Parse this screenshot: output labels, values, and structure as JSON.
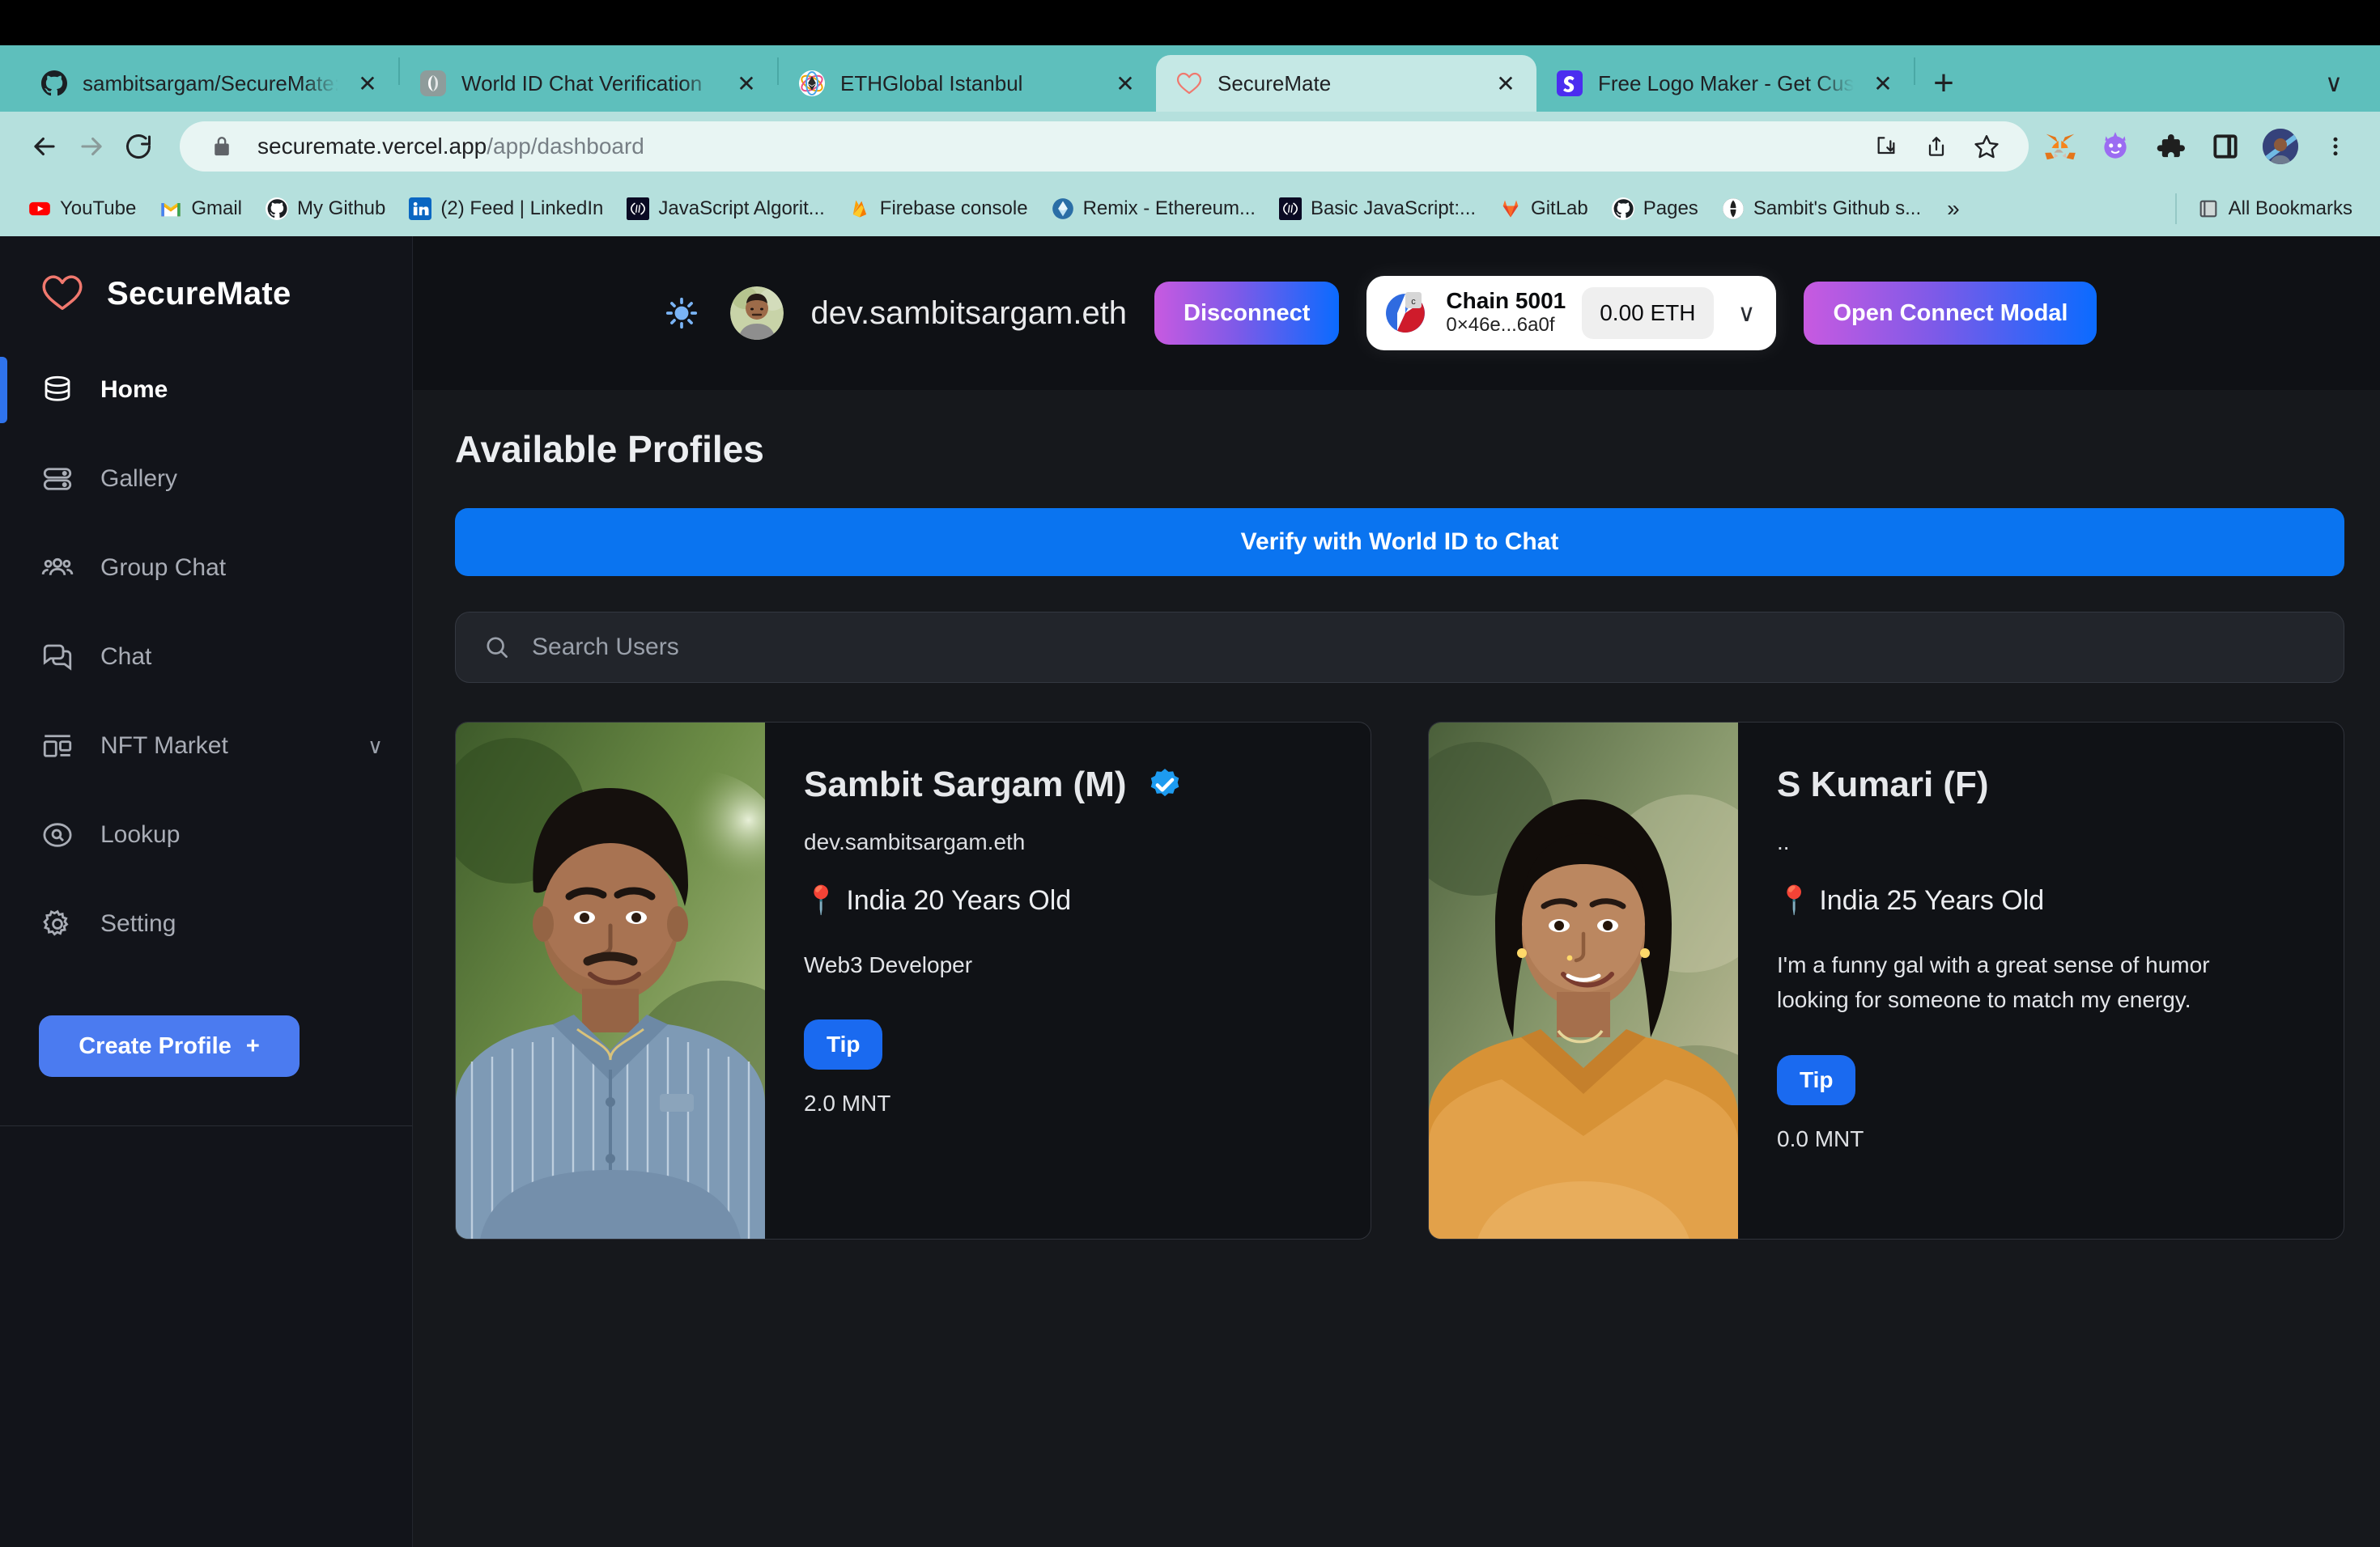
{
  "browser": {
    "tabs": [
      {
        "title": "sambitsargam/SecureMate: Se",
        "favicon": "github-icon",
        "active": false
      },
      {
        "title": "World ID Chat Verification",
        "favicon": "worldid-icon",
        "active": false
      },
      {
        "title": "ETHGlobal Istanbul",
        "favicon": "ethglobal-icon",
        "active": false
      },
      {
        "title": "SecureMate",
        "favicon": "heart-icon",
        "active": true
      },
      {
        "title": "Free Logo Maker - Get Custom",
        "favicon": "looka-icon",
        "active": false
      }
    ],
    "new_tab_label": "+",
    "tab_list_caret": "∨",
    "address": {
      "host": "securemate.vercel.app",
      "path": "/app/dashboard",
      "lock": "lock-icon"
    },
    "nav": {
      "back": "←",
      "forward": "→",
      "reload": "↻"
    },
    "bookmarks": [
      {
        "label": "YouTube",
        "icon": "youtube-icon"
      },
      {
        "label": "Gmail",
        "icon": "gmail-icon"
      },
      {
        "label": "My Github",
        "icon": "github-icon"
      },
      {
        "label": "(2) Feed | LinkedIn",
        "icon": "linkedin-icon"
      },
      {
        "label": "JavaScript Algorit...",
        "icon": "freecodecamp-icon"
      },
      {
        "label": "Firebase console",
        "icon": "firebase-icon"
      },
      {
        "label": "Remix - Ethereum...",
        "icon": "remix-icon"
      },
      {
        "label": "Basic JavaScript:...",
        "icon": "freecodecamp-icon"
      },
      {
        "label": "GitLab",
        "icon": "gitlab-icon"
      },
      {
        "label": "Pages",
        "icon": "github-icon"
      },
      {
        "label": "Sambit's Github s...",
        "icon": "globe-icon"
      }
    ],
    "bookmarks_overflow": "»",
    "all_bookmarks_label": "All Bookmarks",
    "all_bookmarks_icon": "folder-icon"
  },
  "sidebar": {
    "brand": {
      "name": "SecureMate",
      "logo": "heart-logo-icon"
    },
    "items": [
      {
        "label": "Home",
        "icon": "database-icon",
        "active": true,
        "caret": ""
      },
      {
        "label": "Gallery",
        "icon": "gallery-icon",
        "active": false,
        "caret": ""
      },
      {
        "label": "Group Chat",
        "icon": "people-icon",
        "active": false,
        "caret": ""
      },
      {
        "label": "Chat",
        "icon": "chat-bubble-icon",
        "active": false,
        "caret": ""
      },
      {
        "label": "NFT Market",
        "icon": "grid-icon",
        "active": false,
        "caret": "∨"
      },
      {
        "label": "Lookup",
        "icon": "magnifier-circle-icon",
        "active": false,
        "caret": ""
      },
      {
        "label": "Setting",
        "icon": "gear-icon",
        "active": false,
        "caret": ""
      }
    ],
    "create_profile_label": "Create Profile",
    "create_profile_plus": "+"
  },
  "header": {
    "theme_toggle_icon": "sun-icon",
    "avatar_icon": "user-avatar",
    "ens_name": "dev.sambitsargam.eth",
    "disconnect_label": "Disconnect",
    "wallet": {
      "chain": "Chain 5001",
      "address": "0×46e...6a0f",
      "balance": "0.00 ETH",
      "caret": "∨",
      "network_icon": "mantle-network-icon"
    },
    "connect_modal_label": "Open Connect Modal"
  },
  "main": {
    "page_title": "Available Profiles",
    "verify_button_label": "Verify with World ID to Chat",
    "search": {
      "placeholder": "Search Users",
      "value": "",
      "icon": "search-icon"
    },
    "profiles": [
      {
        "name": "Sambit Sargam (M)",
        "verified": true,
        "handle": "dev.sambitsargam.eth",
        "location_pin": "📍",
        "location": "India 20 Years Old",
        "bio": "Web3 Developer",
        "tip_label": "Tip",
        "tip_amount": "2.0 MNT",
        "photo": "male-portrait"
      },
      {
        "name": "S Kumari (F)",
        "verified": false,
        "handle": "..",
        "location_pin": "📍",
        "location": "India 25 Years Old",
        "bio": "I'm a funny gal with a great sense of humor looking for someone to match my energy.",
        "tip_label": "Tip",
        "tip_amount": "0.0 MNT",
        "photo": "female-portrait"
      }
    ]
  },
  "colors": {
    "chrome_tabstrip": "#5ebfbc",
    "chrome_toolbar": "#b5e0dd",
    "accent_blue": "#0a74f0",
    "sidebar_bg": "#12141a",
    "app_bg": "#16181c",
    "brand_pink": "#f0786e"
  }
}
